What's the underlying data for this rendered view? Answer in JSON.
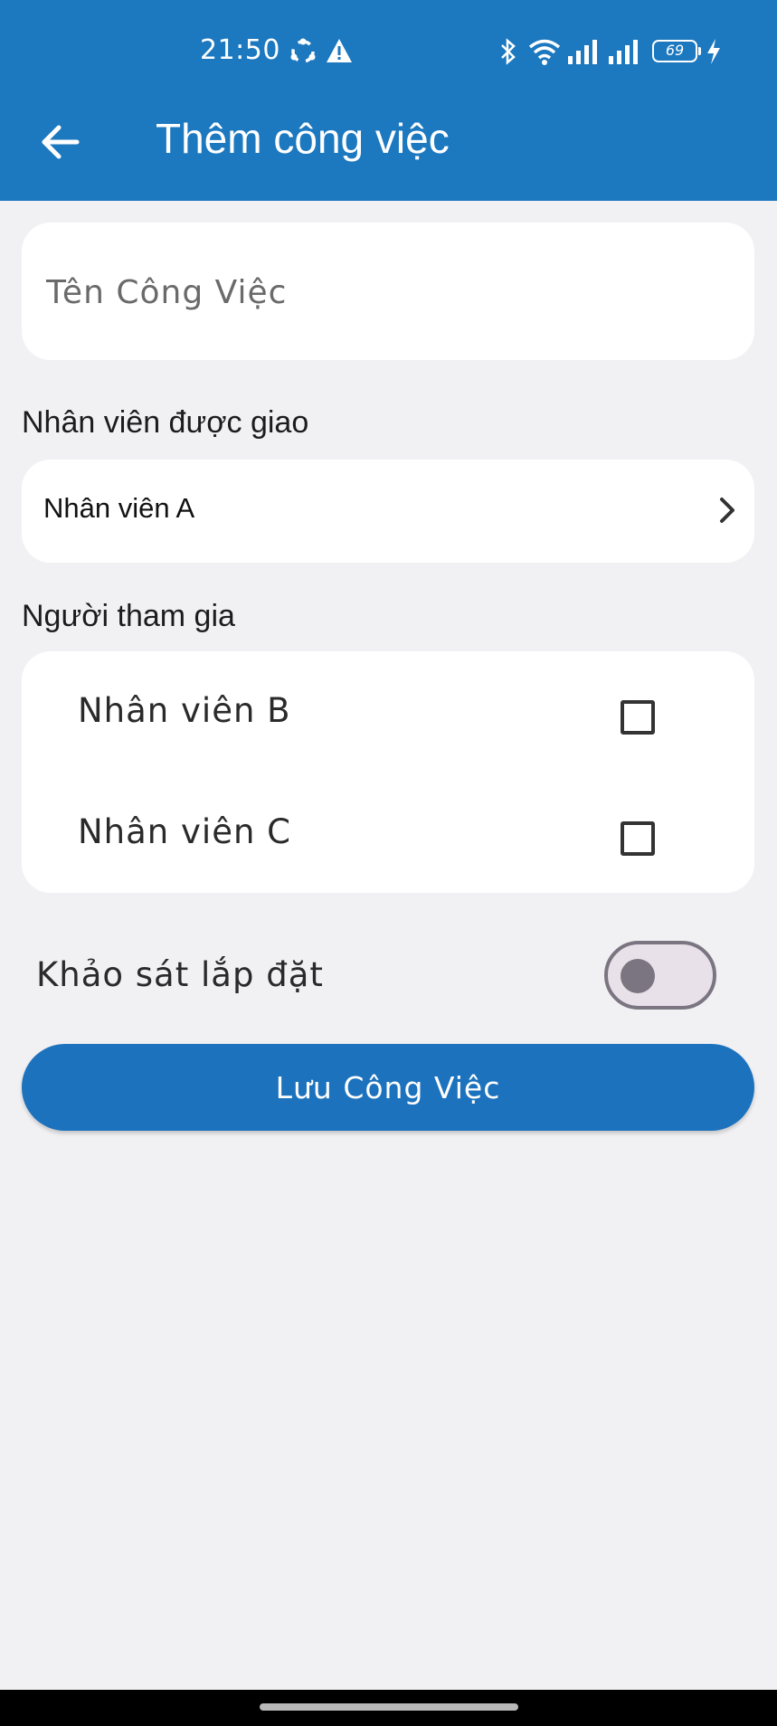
{
  "status_bar": {
    "time": "21:50",
    "battery_level": "69",
    "icons": [
      "sync-icon",
      "warning-icon",
      "bluetooth-icon",
      "wifi-icon",
      "signal-icon",
      "signal-icon",
      "charging-icon"
    ]
  },
  "app_bar": {
    "title": "Thêm công việc",
    "back_icon": "arrow-left-icon",
    "background_color": "#1c78bf"
  },
  "form": {
    "task_name": {
      "placeholder": "Tên Công Việc",
      "value": ""
    },
    "assigned_label": "Nhân viên được giao",
    "assigned_value": "Nhân viên A",
    "participants_label": "Người tham gia",
    "participants": [
      {
        "name": "Nhân viên B",
        "checked": false
      },
      {
        "name": "Nhân viên C",
        "checked": false
      }
    ],
    "survey_label": "Khảo sát lắp đặt",
    "survey_enabled": false,
    "save_button": "Lưu Công Việc"
  },
  "colors": {
    "primary": "#1c72bd",
    "background": "#f1f1f4",
    "card": "#ffffff"
  }
}
